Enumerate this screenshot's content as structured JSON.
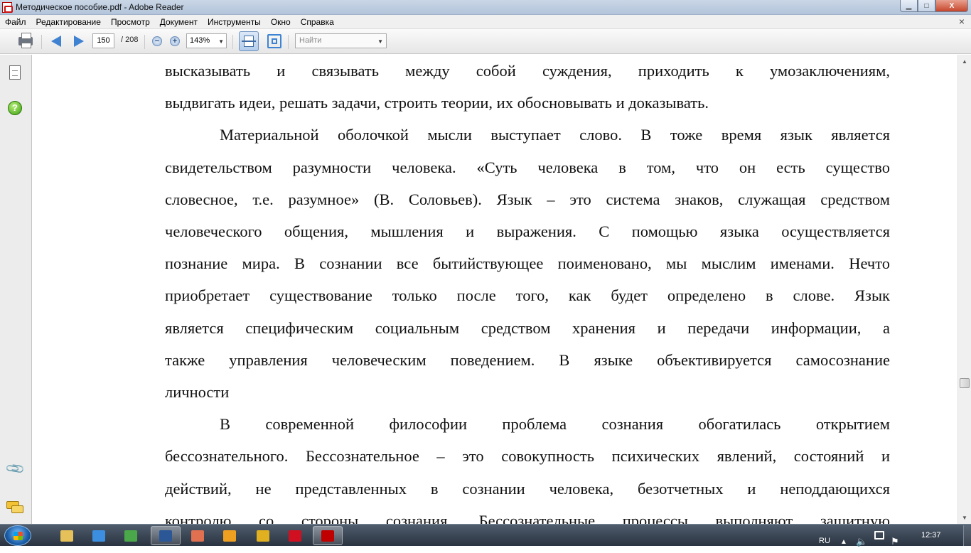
{
  "window": {
    "title": "Методическое пособие.pdf - Adobe Reader",
    "controls": {
      "minimize": "▁",
      "maximize": "□",
      "close": "X"
    }
  },
  "menu": {
    "items": [
      "Файл",
      "Редактирование",
      "Просмотр",
      "Документ",
      "Инструменты",
      "Окно",
      "Справка"
    ],
    "close_doc": "×"
  },
  "toolbar": {
    "icons": [
      "print-icon",
      "previous-page-icon",
      "next-page-icon",
      "zoom-out-icon",
      "zoom-in-icon",
      "fit-page-icon",
      "fit-window-icon"
    ],
    "page_current": "150",
    "page_total": "/ 208",
    "zoom_out": "−",
    "zoom_in": "+",
    "zoom": "143%",
    "find_placeholder": "Найти",
    "dropdown_arrow": "▼"
  },
  "navpane": {
    "icons": [
      "pages-icon",
      "help-icon",
      "attachments-icon",
      "comments-icon"
    ],
    "help": "?",
    "attachment_glyph": "📎"
  },
  "document": {
    "paragraphs": [
      {
        "indent": false,
        "lines": [
          "высказывать и связывать между собой суждения, приходить к умозаключениям,",
          "выдвигать идеи, решать задачи, строить теории, их обосновывать и доказывать."
        ]
      },
      {
        "indent": true,
        "lines": [
          "Материальной оболочкой мысли выступает слово. В тоже время язык является",
          "свидетельством разумности человека. «Суть человека в том, что он есть существо",
          "словесное, т.е. разумное» (В. Соловьев). Язык – это система знаков, служащая средством",
          "человеческого общения, мышления и выражения. С помощью языка осуществляется",
          "познание мира. В сознании все бытийствующее поименовано, мы мыслим именами. Нечто",
          "приобретает существование только после того, как будет определено в слове. Язык",
          "является специфическим социальным средством хранения и передачи информации, а",
          "также управления человеческим поведением. В языке объективируется самосознание",
          "личности"
        ]
      },
      {
        "indent": true,
        "lines": [
          "В современной философии проблема сознания обогатилась открытием",
          "бессознательного. Бессознательное – это совокупность психических явлений, состояний и",
          "действий, не представленных в сознании человека, безотчетных и неподдающихся",
          "контролю со стороны сознания. Бессознательные процессы выполняют защитную"
        ]
      }
    ]
  },
  "scrollbar": {
    "up": "▲",
    "down": "▼"
  },
  "taskbar": {
    "apps": [
      {
        "name": "explorer",
        "color": "#e6c15a",
        "active": false
      },
      {
        "name": "internet-explorer",
        "color": "#3c8fe0",
        "active": false
      },
      {
        "name": "network-app",
        "color": "#4aa84a",
        "active": false
      },
      {
        "name": "word",
        "color": "#2b5797",
        "active": true
      },
      {
        "name": "photo-app",
        "color": "#e07050",
        "active": false
      },
      {
        "name": "media-player",
        "color": "#f0a020",
        "active": false
      },
      {
        "name": "chrome",
        "color": "#e0b020",
        "active": false
      },
      {
        "name": "opera",
        "color": "#d01020",
        "active": false
      },
      {
        "name": "adobe-reader",
        "color": "#c00000",
        "active": true
      }
    ],
    "language": "RU",
    "tray_up": "▲",
    "volume": "🔈",
    "flag": "⚑",
    "clock": "12:37"
  },
  "colors": {
    "accent": "#3f82d1",
    "taskbar": "#2a3340"
  }
}
